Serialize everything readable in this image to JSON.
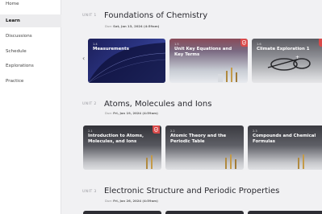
{
  "sidebar": {
    "items": [
      {
        "label": "Home"
      },
      {
        "label": "Learn"
      },
      {
        "label": "Discussions"
      },
      {
        "label": "Schedule"
      },
      {
        "label": "Explorations"
      },
      {
        "label": "Practice"
      }
    ]
  },
  "units": [
    {
      "label": "UNIT 1",
      "title": "Foundations of Chemistry",
      "due_label": "Due:",
      "due": "Sat, Jan 13, 2024 (4:59am)",
      "cards": [
        {
          "num": "1.4",
          "title": "Measurements"
        },
        {
          "num": "1.5",
          "title": "Unit Key Equations and Key Terms"
        },
        {
          "num": "1.6",
          "title": "Climate Exploration 1"
        }
      ]
    },
    {
      "label": "UNIT 2",
      "title": "Atoms, Molecules and Ions",
      "due_label": "Due:",
      "due": "Fri, Jan 19, 2024 (4:59am)",
      "cards": [
        {
          "num": "2.1",
          "title": "Introduction to Atoms, Molecules, and Ions"
        },
        {
          "num": "2.2",
          "title": "Atomic Theory and the Periodic Table"
        },
        {
          "num": "2.3",
          "title": "Compounds and Chemical Formulas"
        }
      ]
    },
    {
      "label": "UNIT 3",
      "title": "Electronic Structure and Periodic Properties",
      "due_label": "Due:",
      "due": "Fri, Jan 26, 2024 (4:59am)"
    }
  ],
  "icons": {
    "prev": "chevron-left-icon",
    "badge": "shield-check-icon"
  },
  "colors": {
    "badge": "#d94a4a",
    "sidebar_active": "#ececee"
  }
}
